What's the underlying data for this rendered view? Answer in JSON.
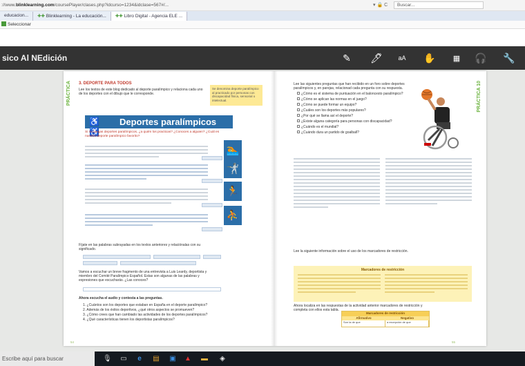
{
  "browser": {
    "url_prefix": "://www.",
    "url_domain": "blinklearning.com",
    "url_rest": "/coursePlayer/clases.php?idcurso=1234&idclase=567#/...",
    "search_label": "Buscar...",
    "tabs": [
      {
        "label": "educacion..."
      },
      {
        "label": "Blinklearning - La educación..."
      },
      {
        "label": "Libro Digital - Agencia ELE ..."
      }
    ],
    "favorites_label": "Seleccionar"
  },
  "app": {
    "title": "sico Al NEdición",
    "tools": [
      {
        "icon": "pencil-icon"
      },
      {
        "icon": "marker-icon"
      },
      {
        "icon": "text-size-icon",
        "label": "aA"
      },
      {
        "icon": "hand-icon"
      },
      {
        "icon": "grid-icon"
      },
      {
        "icon": "audio-icon"
      },
      {
        "icon": "wrench-icon"
      }
    ]
  },
  "book": {
    "left": {
      "side_tag": "PRÁCTICA",
      "section_title": "3. DEPORTE PARA TODOS",
      "intro": "Lee los textos de este blog dedicado al deporte paralímpico y relaciona cada uno de los deportes con el dibujo que le corresponde.",
      "note": "Se denomina deporte paralímpico al practicado por personas con discapacidad física, sensorial o intelectual.",
      "banner_title": "Deportes paralímpicos",
      "banner_subtitle": "Si no juegas deportes paralímpicos, ¿a quién los practicas? ¿Conoces a alguien? ¿Cuál es nuestro deporte paralímpico favorito?",
      "q4": "Fíjate en las palabras subrayadas en los textos anteriores y relaciónalas con su significado.",
      "q5": "Vamos a escuchar un breve fragmento de una entrevista a Luis Leardy, deportista y miembro del Comité Paralímpico Español. Estas son algunas de las palabras y expresiones que escucharás. ¿Las conoces?",
      "q6": "Ahora escucha el audio y contesta a las preguntas.",
      "questions": [
        "1. ¿Cuántos son los deportes que estaban en España en el deporte paralímpico?",
        "2. Además de los éxitos deportivos, ¿qué otros aspectos se promueven?",
        "3. ¿Cómo crees que han cambiado las actividades de los deportes paralímpicos?",
        "4. ¿Qué características tienen los deportistas paralímpicos?"
      ],
      "page_number": "54"
    },
    "right": {
      "side_tag": "PRÁCTICA 10",
      "q1": "Lee las siguientes preguntas que han recibido en un foro sobre deportes paralímpicos y, en parejas, relacionad cada pregunta con su respuesta.",
      "checklist": [
        "¿Cómo es el sistema de puntuación en el baloncesto paralímpico?",
        "¿Cómo se aplican las normas en el juego?",
        "¿Cómo se puede formar un equipo?",
        "¿Cuáles son los deportes más populares?",
        "¿Por qué se llama así el deporte?",
        "¿Existe alguna categoría para personas con discapacidad?",
        "¿Cuándo es el mundial?",
        "¿Cuándo dura un partido de goalball?"
      ],
      "q2": "Lee la siguiente información sobre el uso de los marcadores de restricción.",
      "box_title": "Marcadores de restricción",
      "q3": "Ahora localiza en las respuestas de la actividad anterior marcadores de restricción y completa con ellos esta tabla.",
      "table_title": "Marcadores de restricción",
      "table_cols": [
        "Afirmativo",
        "Negativo"
      ],
      "table_row": [
        "Son la de que",
        "a excepción de que"
      ],
      "page_number": "55"
    }
  },
  "taskbar": {
    "search_placeholder": "Escribe aquí para buscar",
    "icons": [
      "microphone-icon",
      "task-view-icon",
      "edge-icon",
      "explorer-icon",
      "store-icon",
      "acrobat-icon",
      "folder-icon",
      "app-icon"
    ]
  }
}
